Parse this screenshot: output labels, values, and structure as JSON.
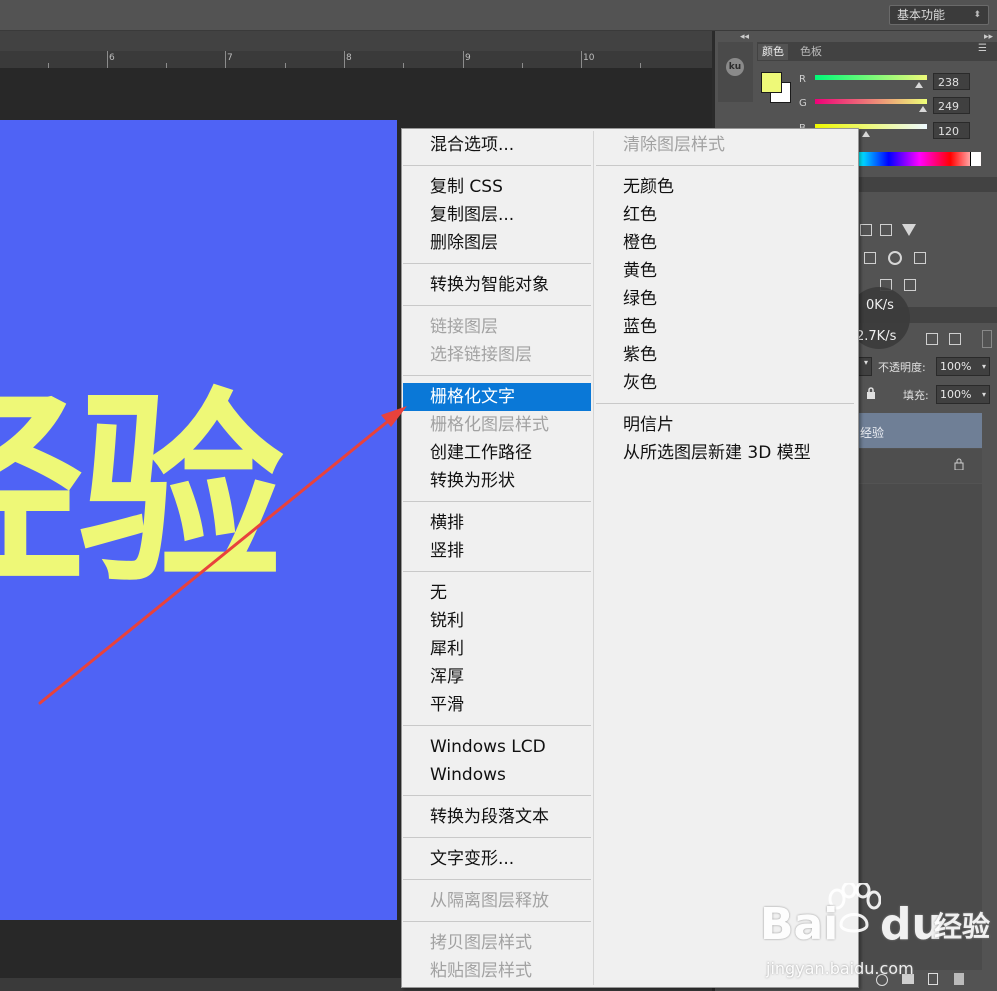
{
  "topbar": {
    "workspace": "基本功能"
  },
  "ruler": {
    "labels": [
      "6",
      "7",
      "8",
      "9",
      "10"
    ]
  },
  "canvas": {
    "text": "经验",
    "text_color": "#eef877",
    "background_color": "#4f63f5"
  },
  "color_panel": {
    "tabs": [
      "颜色",
      "色板"
    ],
    "channels": [
      {
        "label": "R",
        "value": "238"
      },
      {
        "label": "G",
        "value": "249"
      },
      {
        "label": "B",
        "value": "120"
      }
    ]
  },
  "network": {
    "upload": "0K/s",
    "download": "2.7K/s"
  },
  "layers_panel": {
    "opacity_label": "不透明度:",
    "opacity_value": "100%",
    "fill_label": "填充:",
    "fill_value": "100%",
    "layer_name": "经验"
  },
  "context_menu": {
    "left_items": [
      {
        "label": "混合选项...",
        "disabled": false
      },
      {
        "label": "复制 CSS",
        "disabled": false
      },
      {
        "label": "复制图层...",
        "disabled": false
      },
      {
        "label": "删除图层",
        "disabled": false
      },
      {
        "label": "转换为智能对象",
        "disabled": false
      },
      {
        "label": "链接图层",
        "disabled": true
      },
      {
        "label": "选择链接图层",
        "disabled": true
      },
      {
        "label": "栅格化文字",
        "disabled": false,
        "highlighted": true
      },
      {
        "label": "栅格化图层样式",
        "disabled": true
      },
      {
        "label": "创建工作路径",
        "disabled": false
      },
      {
        "label": "转换为形状",
        "disabled": false
      },
      {
        "label": "横排",
        "disabled": false
      },
      {
        "label": "竖排",
        "disabled": false
      },
      {
        "label": "无",
        "disabled": false
      },
      {
        "label": "锐利",
        "disabled": false
      },
      {
        "label": "犀利",
        "disabled": false
      },
      {
        "label": "浑厚",
        "disabled": false
      },
      {
        "label": "平滑",
        "disabled": false
      },
      {
        "label": "Windows LCD",
        "disabled": false
      },
      {
        "label": "Windows",
        "disabled": false
      },
      {
        "label": "转换为段落文本",
        "disabled": false
      },
      {
        "label": "文字变形...",
        "disabled": false
      },
      {
        "label": "从隔离图层释放",
        "disabled": true
      },
      {
        "label": "拷贝图层样式",
        "disabled": true
      },
      {
        "label": "粘贴图层样式",
        "disabled": true
      }
    ],
    "right_items": [
      {
        "label": "清除图层样式",
        "disabled": true
      },
      {
        "label": "无颜色",
        "disabled": false
      },
      {
        "label": "红色",
        "disabled": false
      },
      {
        "label": "橙色",
        "disabled": false
      },
      {
        "label": "黄色",
        "disabled": false
      },
      {
        "label": "绿色",
        "disabled": false
      },
      {
        "label": "蓝色",
        "disabled": false
      },
      {
        "label": "紫色",
        "disabled": false
      },
      {
        "label": "灰色",
        "disabled": false
      },
      {
        "label": "明信片",
        "disabled": false
      },
      {
        "label": "从所选图层新建 3D 模型",
        "disabled": false
      }
    ]
  },
  "watermark": {
    "brand": "Bai",
    "brand2": "du",
    "suffix": "经验",
    "url": "jingyan.baidu.com"
  },
  "colors": {
    "highlight": "#0a78d7",
    "arrow": "#e8423c"
  }
}
